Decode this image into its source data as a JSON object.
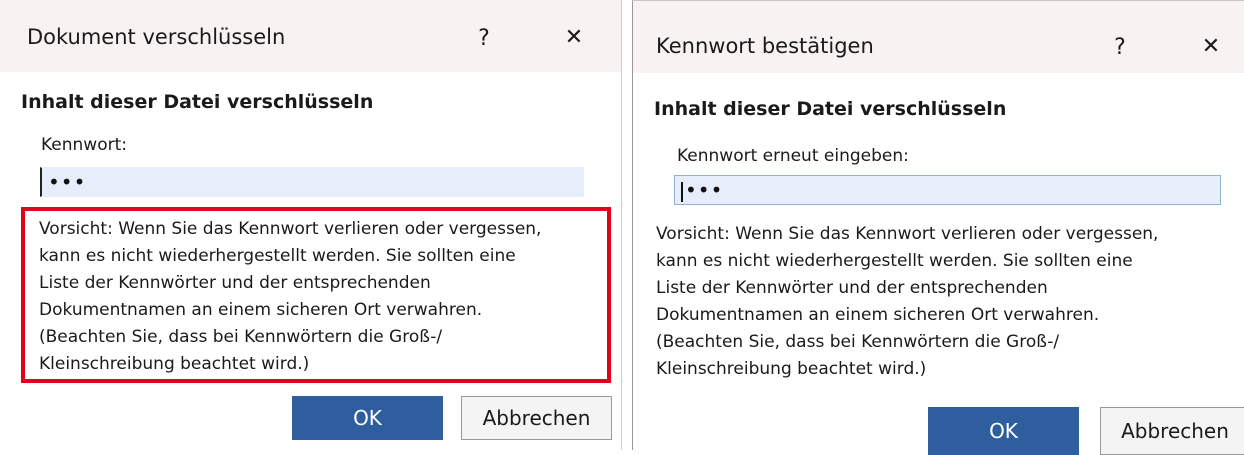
{
  "dialog_encrypt": {
    "title": "Dokument verschlüsseln",
    "help_label": "?",
    "close_label": "✕",
    "heading": "Inhalt dieser Datei verschlüsseln",
    "field_label": "Kennwort:",
    "password_mask": "•••",
    "warning": "Vorsicht: Wenn Sie das Kennwort verlieren oder vergessen,\nkann es nicht wiederhergestellt werden. Sie sollten eine\nListe der Kennwörter und der entsprechenden\nDokumentnamen an einem sicheren Ort verwahren.\n(Beachten Sie, dass bei Kennwörtern die Groß-/\nKleinschreibung beachtet wird.)",
    "ok_label": "OK",
    "cancel_label": "Abbrechen",
    "highlight_color": "#e3001b"
  },
  "dialog_confirm": {
    "title": "Kennwort bestätigen",
    "help_label": "?",
    "close_label": "✕",
    "heading": "Inhalt dieser Datei verschlüsseln",
    "field_label": "Kennwort erneut eingeben:",
    "password_mask": "•••",
    "warning": "Vorsicht: Wenn Sie das Kennwort verlieren oder vergessen,\nkann es nicht wiederhergestellt werden. Sie sollten eine\nListe der Kennwörter und der entsprechenden\nDokumentnamen an einem sicheren Ort verwahren.\n(Beachten Sie, dass bei Kennwörtern die Groß-/\nKleinschreibung beachtet wird.)",
    "ok_label": "OK",
    "cancel_label": "Abbrechen"
  },
  "colors": {
    "titlebar_bg": "#f9f2f2",
    "input_bg": "#e6eefb",
    "ok_button": "#2f5e9e"
  }
}
